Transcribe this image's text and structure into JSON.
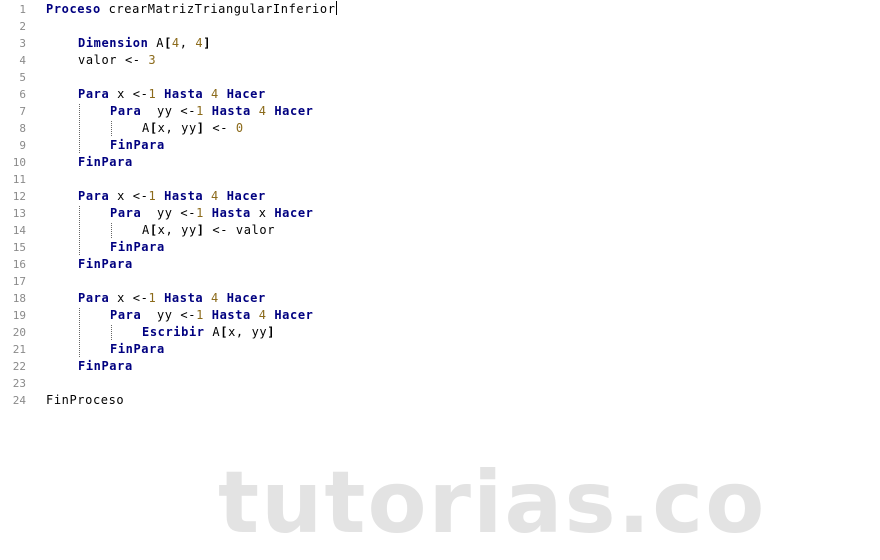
{
  "editor": {
    "lines": [
      {
        "n": "1",
        "indent": 0,
        "tokens": [
          {
            "t": "Proceso",
            "c": "kw"
          },
          {
            "t": " crearMatrizTriangularInferior"
          }
        ],
        "cursor": true
      },
      {
        "n": "2",
        "indent": 0,
        "tokens": []
      },
      {
        "n": "3",
        "indent": 1,
        "tokens": [
          {
            "t": "Dimension",
            "c": "kw"
          },
          {
            "t": " A"
          },
          {
            "t": "[",
            "c": "br"
          },
          {
            "t": "4",
            "c": "num"
          },
          {
            "t": ", "
          },
          {
            "t": "4",
            "c": "num"
          },
          {
            "t": "]",
            "c": "br"
          }
        ]
      },
      {
        "n": "4",
        "indent": 1,
        "tokens": [
          {
            "t": "valor <- "
          },
          {
            "t": "3",
            "c": "num"
          }
        ]
      },
      {
        "n": "5",
        "indent": 0,
        "tokens": []
      },
      {
        "n": "6",
        "indent": 1,
        "tokens": [
          {
            "t": "Para",
            "c": "kw"
          },
          {
            "t": " x <-"
          },
          {
            "t": "1",
            "c": "num"
          },
          {
            "t": " "
          },
          {
            "t": "Hasta",
            "c": "kw"
          },
          {
            "t": " "
          },
          {
            "t": "4",
            "c": "num"
          },
          {
            "t": " "
          },
          {
            "t": "Hacer",
            "c": "kw"
          }
        ]
      },
      {
        "n": "7",
        "indent": 2,
        "tokens": [
          {
            "t": "Para",
            "c": "kw"
          },
          {
            "t": "  yy <-"
          },
          {
            "t": "1",
            "c": "num"
          },
          {
            "t": " "
          },
          {
            "t": "Hasta",
            "c": "kw"
          },
          {
            "t": " "
          },
          {
            "t": "4",
            "c": "num"
          },
          {
            "t": " "
          },
          {
            "t": "Hacer",
            "c": "kw"
          }
        ]
      },
      {
        "n": "8",
        "indent": 3,
        "tokens": [
          {
            "t": "A"
          },
          {
            "t": "[",
            "c": "br"
          },
          {
            "t": "x, yy"
          },
          {
            "t": "]",
            "c": "br"
          },
          {
            "t": " <- "
          },
          {
            "t": "0",
            "c": "num"
          }
        ]
      },
      {
        "n": "9",
        "indent": 2,
        "tokens": [
          {
            "t": "FinPara",
            "c": "kw"
          }
        ]
      },
      {
        "n": "10",
        "indent": 1,
        "tokens": [
          {
            "t": "FinPara",
            "c": "kw"
          }
        ]
      },
      {
        "n": "11",
        "indent": 0,
        "tokens": []
      },
      {
        "n": "12",
        "indent": 1,
        "tokens": [
          {
            "t": "Para",
            "c": "kw"
          },
          {
            "t": " x <-"
          },
          {
            "t": "1",
            "c": "num"
          },
          {
            "t": " "
          },
          {
            "t": "Hasta",
            "c": "kw"
          },
          {
            "t": " "
          },
          {
            "t": "4",
            "c": "num"
          },
          {
            "t": " "
          },
          {
            "t": "Hacer",
            "c": "kw"
          }
        ]
      },
      {
        "n": "13",
        "indent": 2,
        "tokens": [
          {
            "t": "Para",
            "c": "kw"
          },
          {
            "t": "  yy <-"
          },
          {
            "t": "1",
            "c": "num"
          },
          {
            "t": " "
          },
          {
            "t": "Hasta",
            "c": "kw"
          },
          {
            "t": " x "
          },
          {
            "t": "Hacer",
            "c": "kw"
          }
        ]
      },
      {
        "n": "14",
        "indent": 3,
        "tokens": [
          {
            "t": "A"
          },
          {
            "t": "[",
            "c": "br"
          },
          {
            "t": "x, yy"
          },
          {
            "t": "]",
            "c": "br"
          },
          {
            "t": " <- valor"
          }
        ]
      },
      {
        "n": "15",
        "indent": 2,
        "tokens": [
          {
            "t": "FinPara",
            "c": "kw"
          }
        ]
      },
      {
        "n": "16",
        "indent": 1,
        "tokens": [
          {
            "t": "FinPara",
            "c": "kw"
          }
        ]
      },
      {
        "n": "17",
        "indent": 0,
        "tokens": []
      },
      {
        "n": "18",
        "indent": 1,
        "tokens": [
          {
            "t": "Para",
            "c": "kw"
          },
          {
            "t": " x <-"
          },
          {
            "t": "1",
            "c": "num"
          },
          {
            "t": " "
          },
          {
            "t": "Hasta",
            "c": "kw"
          },
          {
            "t": " "
          },
          {
            "t": "4",
            "c": "num"
          },
          {
            "t": " "
          },
          {
            "t": "Hacer",
            "c": "kw"
          }
        ]
      },
      {
        "n": "19",
        "indent": 2,
        "tokens": [
          {
            "t": "Para",
            "c": "kw"
          },
          {
            "t": "  yy <-"
          },
          {
            "t": "1",
            "c": "num"
          },
          {
            "t": " "
          },
          {
            "t": "Hasta",
            "c": "kw"
          },
          {
            "t": " "
          },
          {
            "t": "4",
            "c": "num"
          },
          {
            "t": " "
          },
          {
            "t": "Hacer",
            "c": "kw"
          }
        ]
      },
      {
        "n": "20",
        "indent": 3,
        "tokens": [
          {
            "t": "Escribir",
            "c": "kw"
          },
          {
            "t": " A"
          },
          {
            "t": "[",
            "c": "br"
          },
          {
            "t": "x, yy"
          },
          {
            "t": "]",
            "c": "br"
          }
        ]
      },
      {
        "n": "21",
        "indent": 2,
        "tokens": [
          {
            "t": "FinPara",
            "c": "kw"
          }
        ]
      },
      {
        "n": "22",
        "indent": 1,
        "tokens": [
          {
            "t": "FinPara",
            "c": "kw"
          }
        ]
      },
      {
        "n": "23",
        "indent": 0,
        "tokens": []
      },
      {
        "n": "24",
        "indent": 0,
        "tokens": [
          {
            "t": "FinProceso"
          }
        ]
      }
    ],
    "guides": [
      {
        "level": 1,
        "from_line": 7,
        "to_line": 9
      },
      {
        "level": 2,
        "from_line": 8,
        "to_line": 8
      },
      {
        "level": 1,
        "from_line": 13,
        "to_line": 15
      },
      {
        "level": 2,
        "from_line": 14,
        "to_line": 14
      },
      {
        "level": 1,
        "from_line": 19,
        "to_line": 21
      },
      {
        "level": 2,
        "from_line": 20,
        "to_line": 20
      }
    ]
  },
  "colors": {
    "keyword": "#000080",
    "number": "#8b6a1a",
    "line_number": "#8a8a8a",
    "watermark": "#e3e3e3"
  },
  "watermark": {
    "text": "tutorias.co"
  }
}
